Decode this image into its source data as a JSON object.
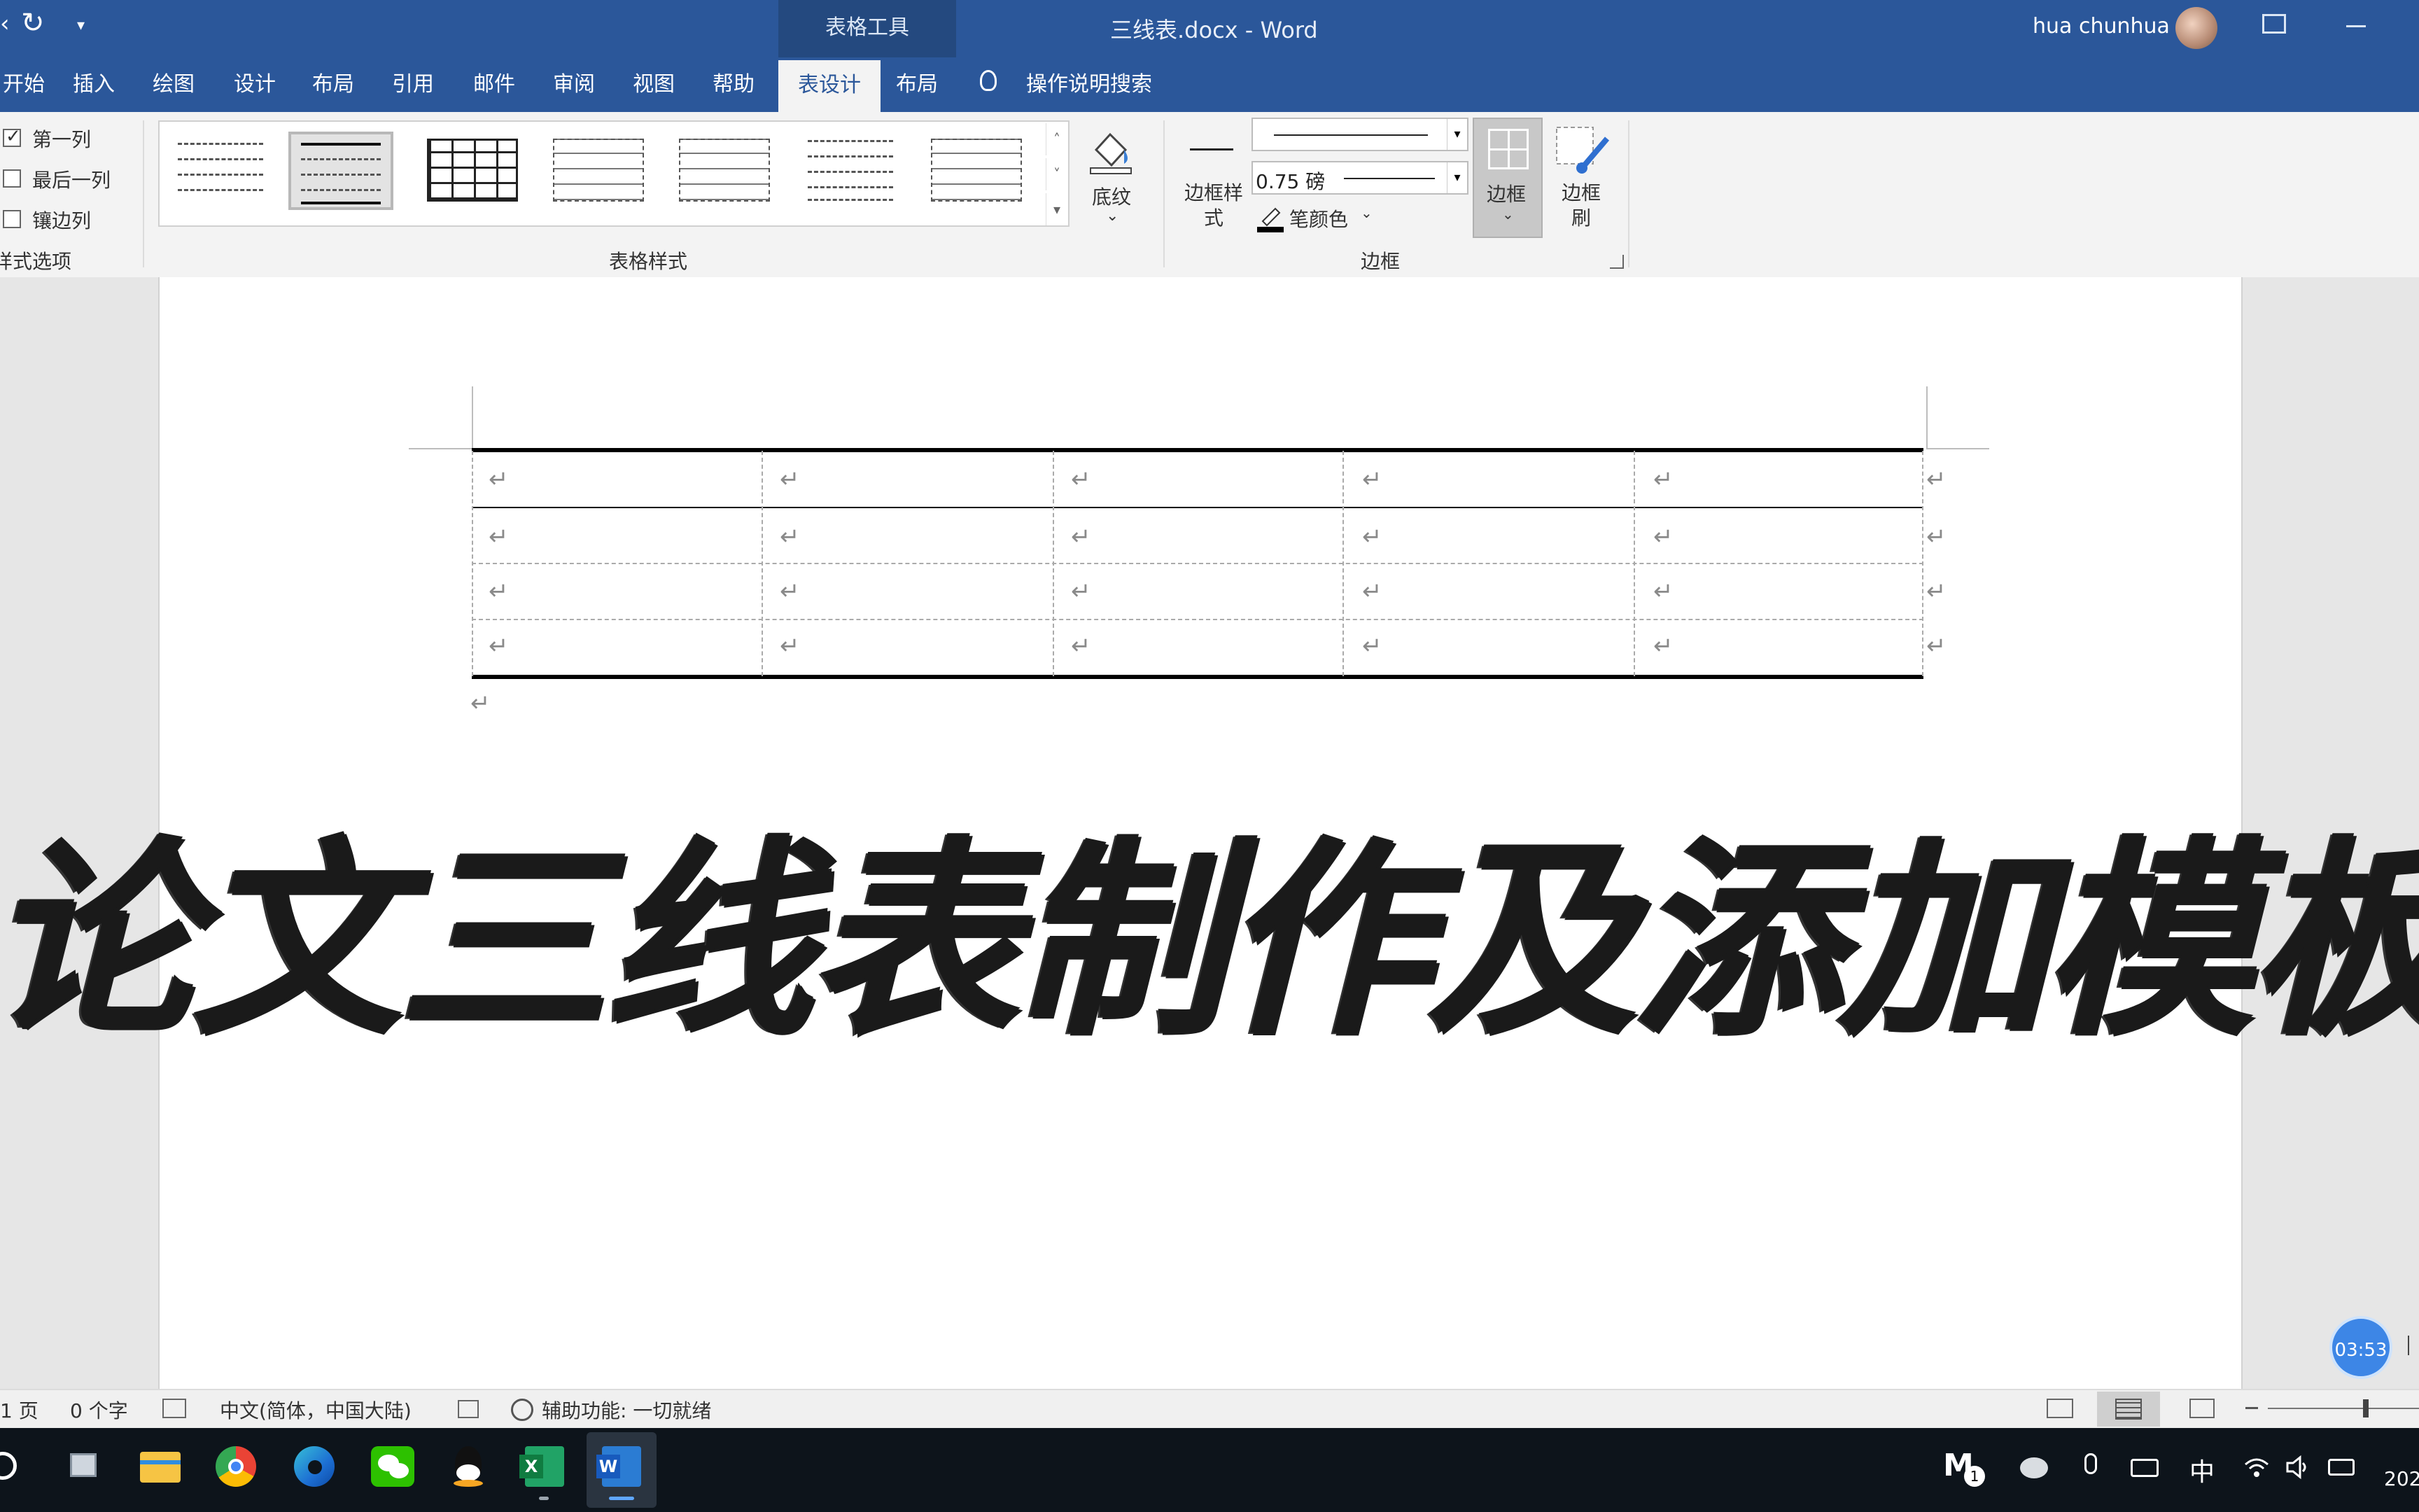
{
  "title_bar": {
    "context_tab": "表格工具",
    "document_title": "三线表.docx - Word",
    "user_name": "hua chunhua"
  },
  "ribbon_tabs": [
    "开始",
    "插入",
    "绘图",
    "设计",
    "布局",
    "引用",
    "邮件",
    "审阅",
    "视图",
    "帮助",
    "表设计",
    "布局"
  ],
  "active_tab": "表设计",
  "search_label": "操作说明搜索",
  "style_options": {
    "items": [
      {
        "label": "第一列",
        "checked": true
      },
      {
        "label": "最后一列",
        "checked": false
      },
      {
        "label": "镶边列",
        "checked": false
      }
    ],
    "group_label": "样式选项"
  },
  "table_styles": {
    "group_label": "表格样式",
    "shading_label": "底纹"
  },
  "borders": {
    "border_styles_label": "边框样式",
    "pen_weight": "0.75 磅",
    "pen_color_label": "笔颜色",
    "borders_label": "边框",
    "border_painter_label": "边框刷",
    "group_label": "边框"
  },
  "document": {
    "table": {
      "rows": 4,
      "cols": 5,
      "cell_mark": "↵"
    },
    "paragraph_mark": "↵",
    "overlay_title": "论文三线表制作及添加模板"
  },
  "timer": "03:53",
  "status_bar": {
    "page": "1 页",
    "words": "0 个字",
    "language": "中文(简体，中国大陆)",
    "accessibility": "辅助功能: 一切就绪"
  },
  "taskbar": {
    "ime_indicator": "中",
    "clock_partial": "202"
  },
  "colors": {
    "word_blue": "#2b579a",
    "ribbon_bg": "#f3f3f3",
    "taskbar_bg": "#0d141b"
  }
}
